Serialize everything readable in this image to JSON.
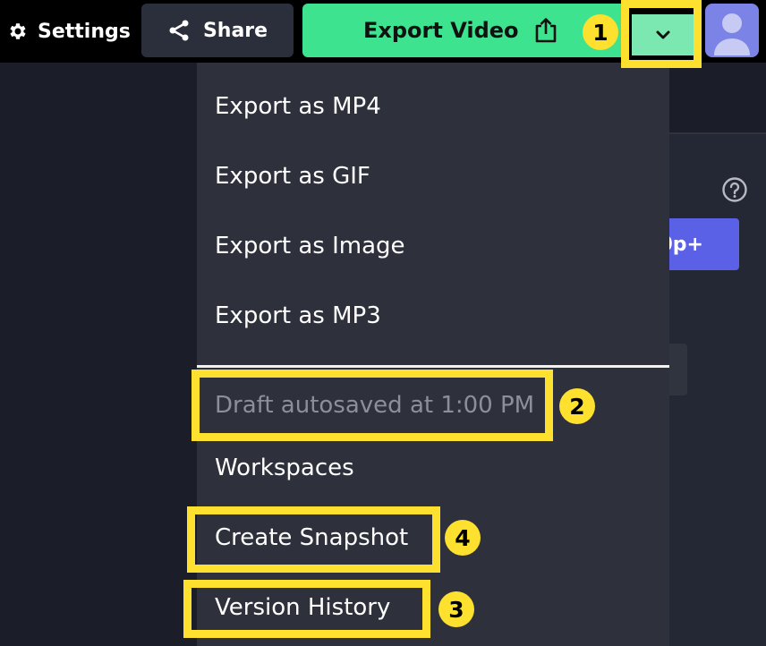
{
  "topbar": {
    "settings_label": "Settings",
    "share_label": "Share",
    "export_label": "Export Video",
    "settings_icon": "gear-icon",
    "share_icon": "share-icon",
    "export_icon": "upload-icon",
    "dropdown_icon": "chevron-down-icon",
    "avatar_icon": "user-icon"
  },
  "background": {
    "resolution_fragment": "0p+",
    "help_icon": "question-circle-icon"
  },
  "menu": {
    "items": [
      {
        "label": "Export as MP4"
      },
      {
        "label": "Export as GIF"
      },
      {
        "label": "Export as Image"
      },
      {
        "label": "Export as MP3"
      }
    ],
    "draft_status": "Draft autosaved at 1:00 PM",
    "workspaces_label": "Workspaces",
    "create_snapshot_label": "Create Snapshot",
    "version_history_label": "Version History"
  },
  "annotations": {
    "badges": [
      "1",
      "2",
      "3",
      "4"
    ],
    "highlight_color": "#fde12e"
  },
  "colors": {
    "export_green": "#3ee38f",
    "accent_purple": "#5b61e6",
    "menu_bg": "#2e313c"
  }
}
